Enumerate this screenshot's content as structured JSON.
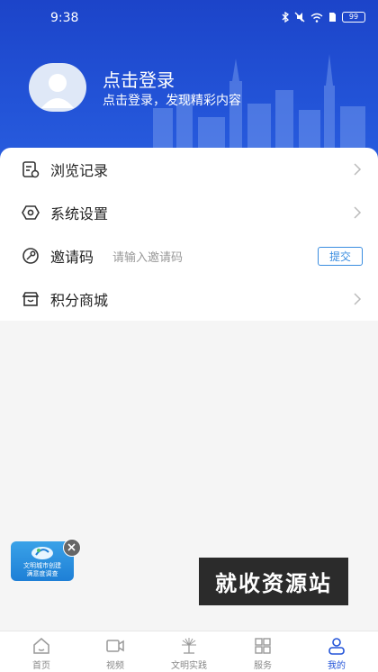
{
  "status_bar": {
    "time": "9:38",
    "battery": "99"
  },
  "profile": {
    "title": "点击登录",
    "subtitle": "点击登录，发现精彩内容"
  },
  "menu": {
    "history": "浏览记录",
    "settings": "系统设置",
    "invite": "邀请码",
    "invite_placeholder": "请输入邀请码",
    "submit": "提交",
    "mall": "积分商城"
  },
  "float_banner": {
    "line1": "文明城市创建",
    "line2": "满意度调查"
  },
  "watermark": "就收资源站",
  "tabs": [
    {
      "label": "首页",
      "icon": "home-icon"
    },
    {
      "label": "视频",
      "icon": "video-icon"
    },
    {
      "label": "文明实践",
      "icon": "civilization-icon"
    },
    {
      "label": "服务",
      "icon": "grid-icon"
    },
    {
      "label": "我的",
      "icon": "user-icon"
    }
  ],
  "colors": {
    "header_blue": "#2354d8",
    "active_tab": "#2354d8",
    "accent": "#3a8de0"
  }
}
